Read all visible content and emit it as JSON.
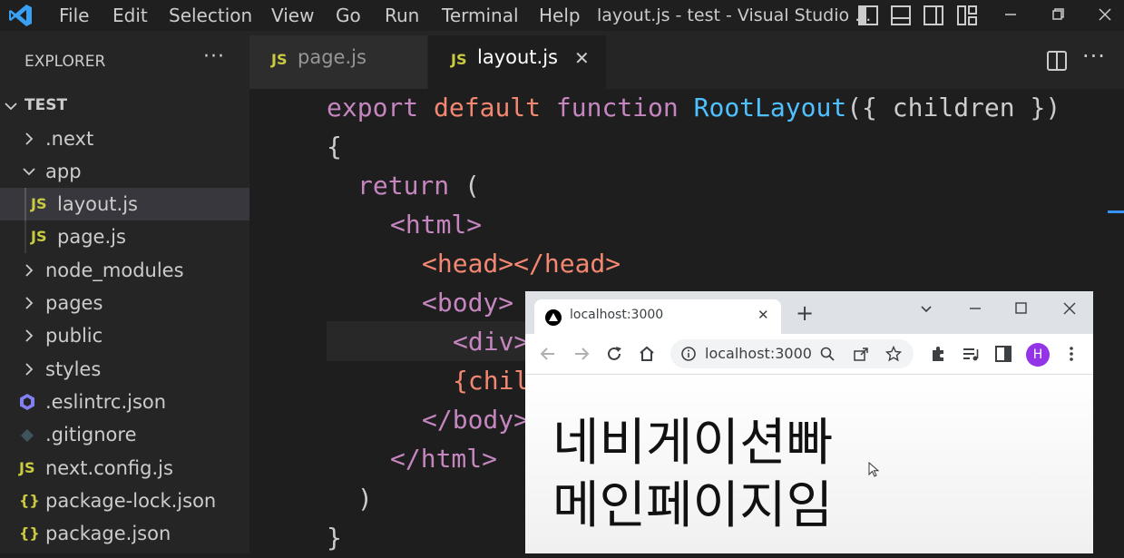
{
  "menubar": {
    "items": [
      "File",
      "Edit",
      "Selection",
      "View",
      "Go",
      "Run",
      "Terminal",
      "Help"
    ],
    "window_title": "layout.js - test - Visual Studio ..."
  },
  "sidebar": {
    "header": "EXPLORER",
    "more": "···",
    "root": "TEST",
    "items": [
      {
        "label": ".next",
        "kind": "folder",
        "expanded": false
      },
      {
        "label": "app",
        "kind": "folder",
        "expanded": true
      },
      {
        "label": "layout.js",
        "kind": "js",
        "icon_text": "JS",
        "selected": true
      },
      {
        "label": "page.js",
        "kind": "js",
        "icon_text": "JS"
      },
      {
        "label": "node_modules",
        "kind": "folder",
        "expanded": false
      },
      {
        "label": "pages",
        "kind": "folder",
        "expanded": false
      },
      {
        "label": "public",
        "kind": "folder",
        "expanded": false
      },
      {
        "label": "styles",
        "kind": "folder",
        "expanded": false
      },
      {
        "label": ".eslintrc.json",
        "kind": "eslint"
      },
      {
        "label": ".gitignore",
        "kind": "git"
      },
      {
        "label": "next.config.js",
        "kind": "js",
        "icon_text": "JS"
      },
      {
        "label": "package-lock.json",
        "kind": "json",
        "icon_text": "{}"
      },
      {
        "label": "package.json",
        "kind": "json",
        "icon_text": "{}"
      }
    ]
  },
  "tabs": [
    {
      "icon_text": "JS",
      "label": "page.js",
      "active": false
    },
    {
      "icon_text": "JS",
      "label": "layout.js",
      "active": true,
      "close": "✕"
    }
  ],
  "editor": {
    "lines": {
      "l1_export": "export",
      "l1_default": "default",
      "l1_function": "function",
      "l1_name": "RootLayout",
      "l1_args": "({ children })",
      "l2": "{",
      "l3_return": "return",
      "l3_paren": "(",
      "l4": "<html>",
      "l5": "<head></head>",
      "l6": "<body>",
      "l7": "<div>",
      "l8": "{chil",
      "l9": "</body>",
      "l10": "</html>",
      "l11": ")",
      "l12": "}"
    }
  },
  "browser": {
    "tab_title": "localhost:3000",
    "tab_close": "✕",
    "new_tab": "+",
    "address": "localhost:3000",
    "avatar_initial": "H",
    "content_line1": "네비게이션빠",
    "content_line2": "메인페이지임"
  },
  "colors": {
    "keyword_purple": "#c586c0",
    "keyword_orange": "#f48771",
    "function_blue": "#569cd6",
    "name_cyan": "#4fc1ff",
    "js_yellow": "#cbcb41",
    "avatar_purple": "#9334e6"
  }
}
